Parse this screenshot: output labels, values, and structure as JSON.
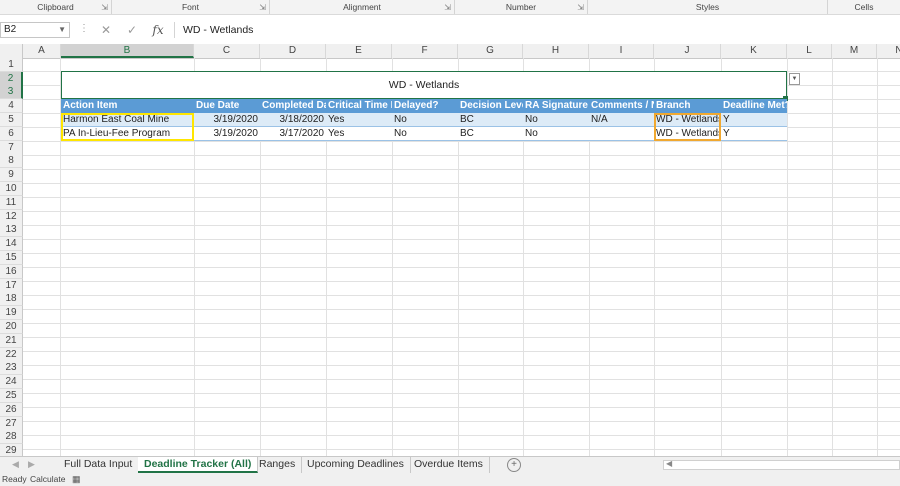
{
  "ribbon": {
    "groups": [
      "Clipboard",
      "Font",
      "Alignment",
      "Number",
      "Styles",
      "Cells"
    ]
  },
  "formula_bar": {
    "name_box": "B2",
    "cancel_icon": "✕",
    "enter_icon": "✓",
    "fx_label": "fx",
    "content": "WD - Wetlands"
  },
  "columns": [
    "A",
    "B",
    "C",
    "D",
    "E",
    "F",
    "G",
    "H",
    "I",
    "J",
    "K",
    "L",
    "M",
    "N"
  ],
  "rows": [
    "1",
    "2",
    "3",
    "4",
    "5",
    "6",
    "7",
    "8",
    "9",
    "10",
    "11",
    "12",
    "13",
    "14",
    "15",
    "16",
    "17",
    "18",
    "19",
    "20",
    "21",
    "22",
    "23",
    "24",
    "25",
    "26",
    "27",
    "28",
    "29"
  ],
  "sheet": {
    "merged_title": "WD - Wetlands",
    "headers": [
      "Action Item",
      "Due Date",
      "Completed Dat",
      "Critical Time Li",
      "Delayed?",
      "Decision Level",
      "RA Signature R",
      "Comments / N",
      "Branch",
      "Deadline Met?"
    ],
    "data_rows": [
      [
        "Harmon East Coal Mine",
        "3/19/2020",
        "3/18/2020",
        "Yes",
        "No",
        "BC",
        "No",
        "N/A",
        "WD - Wetlands",
        "Y"
      ],
      [
        "PA In-Lieu-Fee Program",
        "3/19/2020",
        "3/17/2020",
        "Yes",
        "No",
        "BC",
        "No",
        "",
        "WD - Wetlands",
        "Y"
      ]
    ]
  },
  "tabs": {
    "items": [
      "Full Data Input",
      "Deadline Tracker (All)",
      "Ranges",
      "Upcoming Deadlines",
      "Overdue Items"
    ],
    "active": "Deadline Tracker (All)"
  },
  "status": {
    "ready": "Ready",
    "calculate": "Calculate"
  },
  "colors": {
    "accent": "#217346",
    "table_header": "#5b9bd5",
    "band": "#ddebf7",
    "highlight_yellow": "#ffe600",
    "highlight_orange": "#f0a830"
  }
}
